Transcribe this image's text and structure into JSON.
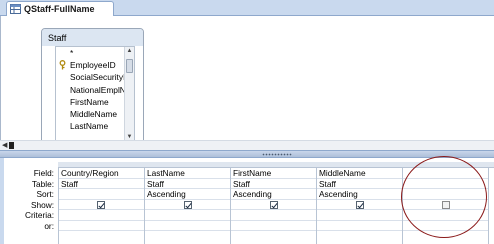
{
  "tab": {
    "title": "QStaff-FullName"
  },
  "table_box": {
    "title": "Staff",
    "fields": [
      "*",
      "EmployeeID",
      "SocialSecurityNu",
      "NationalEmplNu",
      "FirstName",
      "MiddleName",
      "LastName"
    ]
  },
  "grid": {
    "row_labels": [
      "Field:",
      "Table:",
      "Sort:",
      "Show:",
      "Criteria:",
      "or:"
    ],
    "columns": [
      {
        "field": "Country/Region",
        "table": "Staff",
        "sort": "",
        "show": true
      },
      {
        "field": "LastName",
        "table": "Staff",
        "sort": "Ascending",
        "show": true
      },
      {
        "field": "FirstName",
        "table": "Staff",
        "sort": "Ascending",
        "show": true
      },
      {
        "field": "MiddleName",
        "table": "Staff",
        "sort": "Ascending",
        "show": true
      },
      {
        "field": "",
        "table": "",
        "sort": "",
        "show": false
      }
    ]
  },
  "colors": {
    "highlight_circle": "#8b1a1a",
    "chrome": "#c9d9ee"
  }
}
